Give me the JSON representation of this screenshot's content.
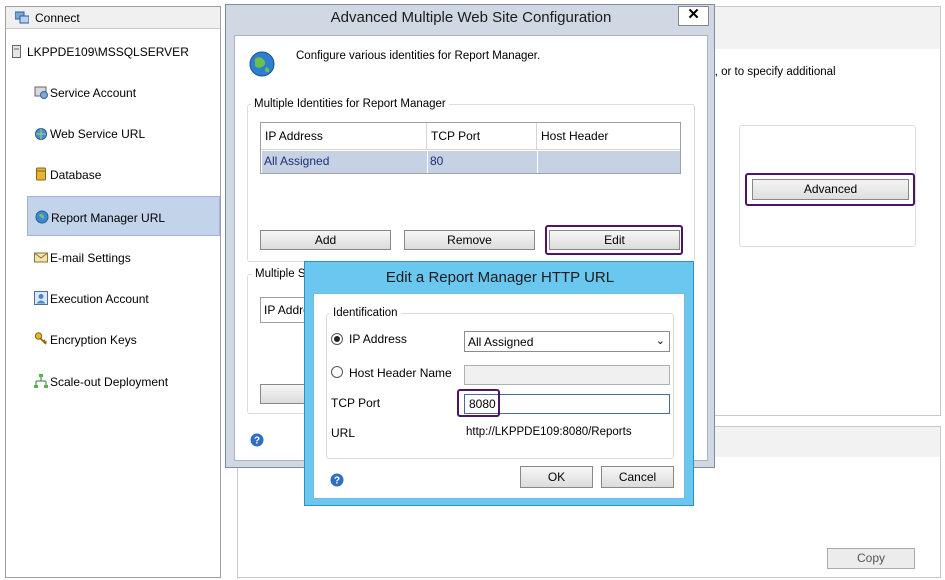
{
  "sidebar": {
    "connect_label": "Connect",
    "server_name": "LKPPDE109\\MSSQLSERVER",
    "items": [
      {
        "label": "Service Account",
        "icon": "service-account-icon",
        "selected": false
      },
      {
        "label": "Web Service URL",
        "icon": "web-service-url-icon",
        "selected": false
      },
      {
        "label": "Database",
        "icon": "database-icon",
        "selected": false
      },
      {
        "label": "Report Manager URL",
        "icon": "report-manager-url-icon",
        "selected": true
      },
      {
        "label": "E-mail Settings",
        "icon": "email-icon",
        "selected": false
      },
      {
        "label": "Execution Account",
        "icon": "execution-account-icon",
        "selected": false
      },
      {
        "label": "Encryption Keys",
        "icon": "keys-icon",
        "selected": false
      },
      {
        "label": "Scale-out Deployment",
        "icon": "scale-out-icon",
        "selected": false
      }
    ]
  },
  "background": {
    "partial_text": "s, or to specify additional",
    "advanced_label": "Advanced",
    "copy_label": "Copy"
  },
  "advanced_dialog": {
    "title": "Advanced Multiple Web Site Configuration",
    "close_glyph": "✕",
    "description": "Configure various identities for Report Manager.",
    "group_label": "Multiple Identities for Report Manager",
    "columns": [
      "IP Address",
      "TCP Port",
      "Host Header"
    ],
    "rows": [
      {
        "ip": "All Assigned",
        "port": "80",
        "host": ""
      }
    ],
    "buttons": {
      "add": "Add",
      "remove": "Remove",
      "edit": "Edit"
    },
    "ssl_group_label": "Multiple SS",
    "ssl_column": "IP Addre"
  },
  "edit_dialog": {
    "title": "Edit a Report Manager HTTP URL",
    "group_label": "Identification",
    "ip_label": "IP Address",
    "ip_value": "All Assigned",
    "host_label": "Host Header Name",
    "host_value": "",
    "port_label": "TCP Port",
    "port_value": "8080",
    "url_label": "URL",
    "url_value": "http://LKPPDE109:8080/Reports",
    "ok_label": "OK",
    "cancel_label": "Cancel"
  },
  "colors": {
    "selection": "#c2d3ea",
    "highlight_box": "#4a166d",
    "edit_dialog_frame": "#6ac7ef"
  }
}
